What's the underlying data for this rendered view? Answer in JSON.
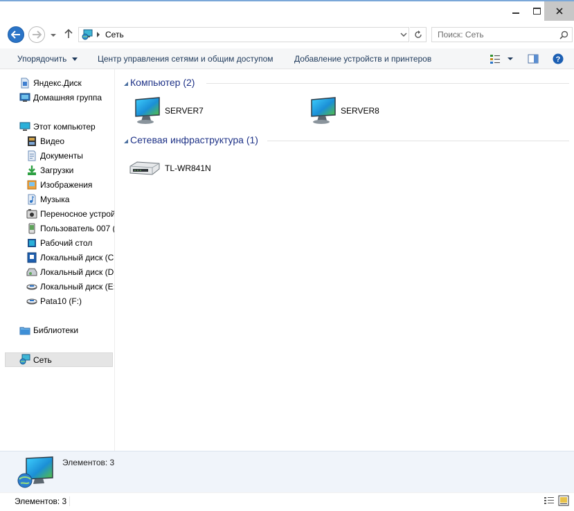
{
  "window": {
    "title": ""
  },
  "nav": {
    "address": "Сеть",
    "search_placeholder": "Поиск: Сеть"
  },
  "commands": {
    "organize": "Упорядочить",
    "network_center": "Центр управления сетями и общим доступом",
    "add_devices": "Добавление устройств и принтеров"
  },
  "sidebar": {
    "items": [
      {
        "label": "Яндекс.Диск",
        "icon": "yandex-disk-icon"
      },
      {
        "label": "Домашняя группа",
        "icon": "homegroup-icon"
      },
      {
        "label": "Этот компьютер",
        "icon": "computer-icon"
      },
      {
        "label": "Видео",
        "icon": "video-folder-icon"
      },
      {
        "label": "Документы",
        "icon": "documents-folder-icon"
      },
      {
        "label": "Загрузки",
        "icon": "downloads-folder-icon"
      },
      {
        "label": "Изображения",
        "icon": "pictures-folder-icon"
      },
      {
        "label": "Музыка",
        "icon": "music-folder-icon"
      },
      {
        "label": "Переносное устрой",
        "icon": "portable-device-icon"
      },
      {
        "label": "Пользователь 007 (",
        "icon": "user-device-icon"
      },
      {
        "label": "Рабочий стол",
        "icon": "desktop-folder-icon"
      },
      {
        "label": "Локальный диск (C",
        "icon": "windows-drive-icon"
      },
      {
        "label": "Локальный диск (D",
        "icon": "drive-icon"
      },
      {
        "label": "Локальный диск (E:",
        "icon": "drive-icon"
      },
      {
        "label": "Pata10 (F:)",
        "icon": "drive-icon"
      },
      {
        "label": "Библиотеки",
        "icon": "libraries-icon"
      },
      {
        "label": "Сеть",
        "icon": "network-icon"
      }
    ]
  },
  "content": {
    "groups": [
      {
        "title": "Компьютер (2)",
        "items": [
          {
            "label": "SERVER7"
          },
          {
            "label": "SERVER8"
          }
        ]
      },
      {
        "title": "Сетевая инфраструктура (1)",
        "items": [
          {
            "label": "TL-WR841N"
          }
        ]
      }
    ]
  },
  "details": {
    "text": "Элементов: 3"
  },
  "status": {
    "text": "Элементов: 3"
  },
  "colors": {
    "accent": "#2a74c7",
    "group_title": "#1e3287",
    "command_text": "#1e395b",
    "selection": "#e5e5e5"
  }
}
